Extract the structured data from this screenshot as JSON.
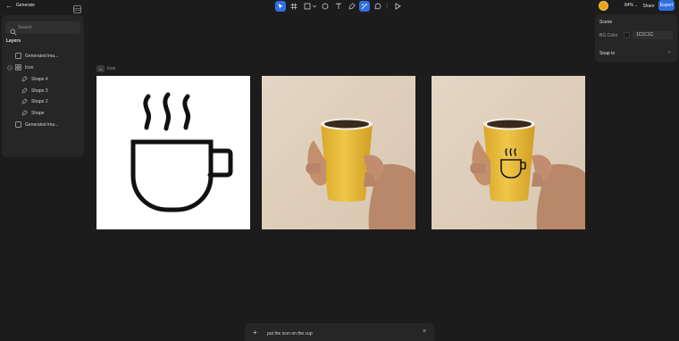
{
  "app": {
    "title": "Generate"
  },
  "search": {
    "placeholder": "Search"
  },
  "layers": {
    "title": "Layers",
    "items": [
      {
        "label": "Generated ima...",
        "icon": "image-icon"
      },
      {
        "label": "Icon",
        "icon": "component-icon"
      },
      {
        "label": "Shape 4",
        "icon": "pen-shape-icon"
      },
      {
        "label": "Shape 3",
        "icon": "pen-shape-icon"
      },
      {
        "label": "Shape 2",
        "icon": "pen-shape-icon"
      },
      {
        "label": "Shape",
        "icon": "pen-shape-icon"
      },
      {
        "label": "Generated ima...",
        "icon": "image-icon"
      }
    ]
  },
  "toolbar": {
    "tools": [
      "select-tool",
      "frame-tool",
      "rectangle-tool",
      "ellipse-tool",
      "text-tool",
      "pen-tool",
      "ai-edit-tool",
      "comment-tool",
      "present-tool"
    ],
    "active_tool": "ai-edit-tool"
  },
  "header": {
    "zoom": "84%",
    "share_label": "Share",
    "export_label": "Export"
  },
  "scene": {
    "title": "Scene",
    "bg_label": "BG Color",
    "bg_value": "1C1C1C",
    "snap_label": "Snap to"
  },
  "canvas": {
    "frame_label": "Icon"
  },
  "prompt": {
    "text": "put the icon on the cup"
  },
  "colors": {
    "accent": "#2f6fe0",
    "avatar": "#e8a21a",
    "cup_yellow": "#e9bf3d",
    "background": "#1c1c1c"
  }
}
